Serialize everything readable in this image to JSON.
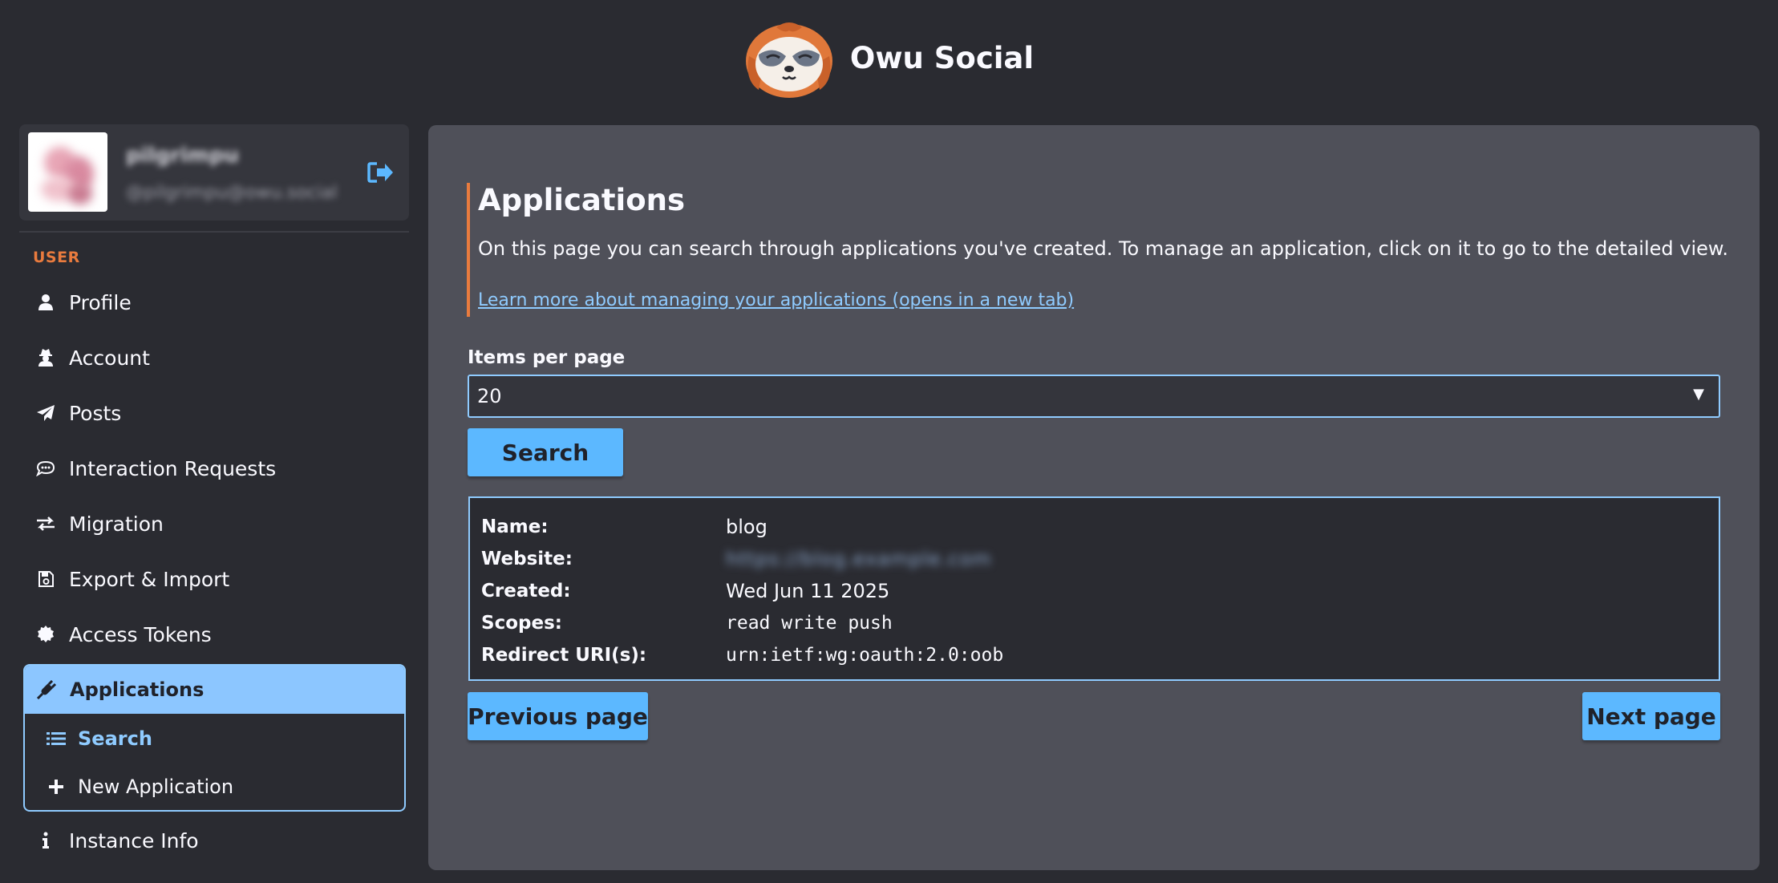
{
  "header": {
    "site_title": "Owu Social",
    "logo_icon": "sloth-logo-icon"
  },
  "user_card": {
    "display_name": "pilgrimpu",
    "account_handle": "@pilgrimpu@owu.social",
    "logout_icon": "logout-icon"
  },
  "sidebar": {
    "section_label": "USER",
    "items": [
      {
        "label": "Profile",
        "icon": "user-icon"
      },
      {
        "label": "Account",
        "icon": "user-secret-icon"
      },
      {
        "label": "Posts",
        "icon": "paper-plane-icon"
      },
      {
        "label": "Interaction Requests",
        "icon": "comments-icon"
      },
      {
        "label": "Migration",
        "icon": "exchange-icon"
      },
      {
        "label": "Export & Import",
        "icon": "floppy-disk-icon"
      },
      {
        "label": "Access Tokens",
        "icon": "certificate-icon"
      }
    ],
    "applications": {
      "label": "Applications",
      "icon": "plug-icon",
      "sub_items": [
        {
          "label": "Search",
          "icon": "list-icon"
        },
        {
          "label": "New Application",
          "icon": "plus-icon"
        }
      ]
    },
    "instance_info": {
      "label": "Instance Info",
      "icon": "info-icon"
    }
  },
  "main": {
    "title": "Applications",
    "description": "On this page you can search through applications you've created. To manage an application, click on it to go to the detailed view.",
    "learn_more_link": "Learn more about managing your applications (opens in a new tab)",
    "items_per_page_label": "Items per page",
    "items_per_page_value": "20",
    "search_button": "Search",
    "application": {
      "name_key": "Name:",
      "name_value": "blog",
      "website_key": "Website:",
      "website_value": "https://blog.example.com",
      "created_key": "Created:",
      "created_value": "Wed Jun 11 2025",
      "scopes_key": "Scopes:",
      "scopes_value": "read write push",
      "redirect_key": "Redirect URI(s):",
      "redirect_value": "urn:ietf:wg:oauth:2.0:oob"
    },
    "previous_button": "Previous page",
    "next_button": "Next page"
  },
  "colors": {
    "accent_orange": "#e97b3e",
    "accent_blue": "#8fcbff",
    "button_blue": "#5cb8ff",
    "background": "#2a2b31",
    "panel": "#4f5059"
  }
}
